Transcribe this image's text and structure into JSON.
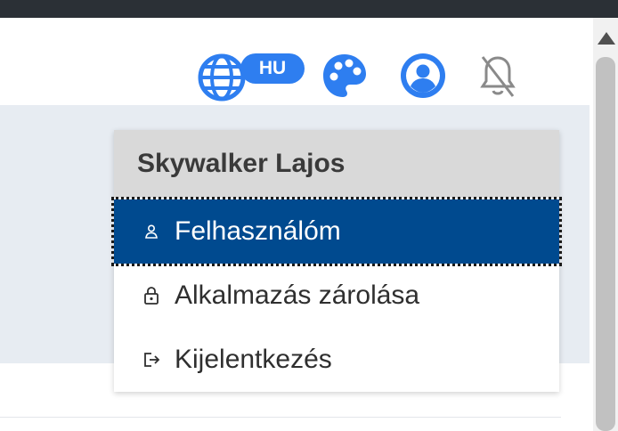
{
  "header": {
    "language_badge": "HU",
    "icons": [
      "globe-icon",
      "palette-icon",
      "user-circle-icon",
      "bell-off-icon"
    ],
    "accent_color": "#2e7ef0"
  },
  "user_menu": {
    "user_name": "Skywalker Lajos",
    "items": [
      {
        "label": "Felhasználóm",
        "icon": "user-icon",
        "active": true
      },
      {
        "label": "Alkalmazás zárolása",
        "icon": "lock-icon",
        "active": false
      },
      {
        "label": "Kijelentkezés",
        "icon": "logout-icon",
        "active": false
      }
    ],
    "active_color": "#004a8f"
  }
}
